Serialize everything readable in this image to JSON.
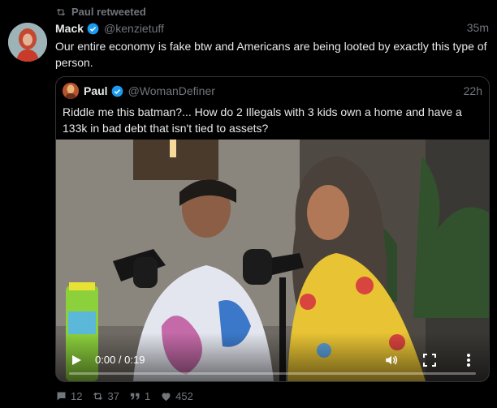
{
  "retweet": {
    "label": "Paul retweeted"
  },
  "tweet": {
    "author_name": "Mack",
    "author_handle": "@kenzietuff",
    "time": "35m",
    "text": "Our entire economy is fake btw and Americans are being looted by exactly this type of person."
  },
  "quote": {
    "author_name": "Paul",
    "author_handle": "@WomanDefiner",
    "time": "22h",
    "text": "Riddle me this batman?... How do 2 Illegals with 3 kids own a home and have a 133k in bad debt that isn't tied to assets?",
    "video": {
      "time_display": "0:00 / 0:19",
      "progress": 0.0
    }
  },
  "actions": {
    "replies": "12",
    "retweets": "37",
    "quotes": "1",
    "likes": "452"
  },
  "colors": {
    "accent": "#1d9bf0",
    "muted": "#71767b",
    "background": "#000000"
  }
}
